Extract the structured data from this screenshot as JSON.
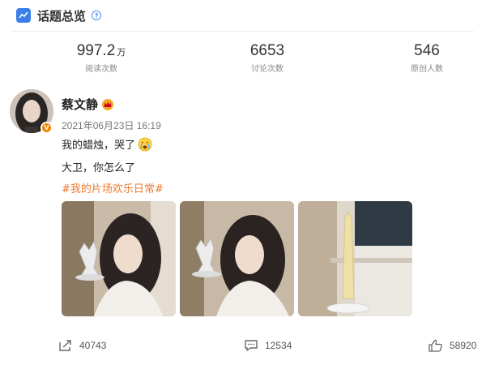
{
  "header": {
    "title": "话题总览",
    "info_symbol": "?"
  },
  "stats": [
    {
      "value": "997.2",
      "unit": "万",
      "label": "阅读次数"
    },
    {
      "value": "6653",
      "unit": "",
      "label": "讨论次数"
    },
    {
      "value": "546",
      "unit": "",
      "label": "原创人数"
    }
  ],
  "post": {
    "author": "蔡文静",
    "verified_badge": "V",
    "time": "2021年06月23日 16:19",
    "line1": "我的蜡烛，哭了",
    "line2": "大卫，你怎么了",
    "hashtag": "#我的片场欢乐日常#",
    "photos": [
      "photo-woman-with-statue-1",
      "photo-woman-with-statue-2",
      "photo-candle"
    ]
  },
  "actions": {
    "share_count": "40743",
    "comment_count": "12534",
    "like_count": "58920"
  },
  "colors": {
    "accent": "#3b7fe8",
    "hashtag": "#f07a2e",
    "badge": "#f08300"
  }
}
